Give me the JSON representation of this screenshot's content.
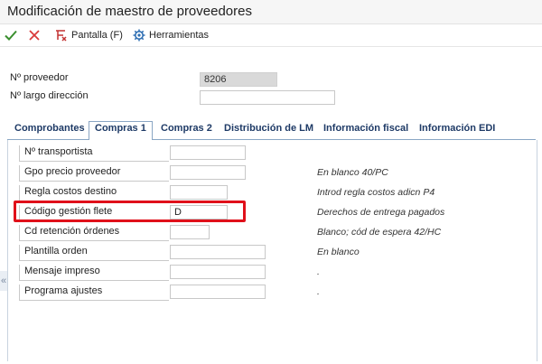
{
  "window": {
    "title": "Modificación de maestro de proveedores"
  },
  "toolbar": {
    "ok_icon": "checkmark-icon",
    "cancel_icon": "x-icon",
    "pantalla_label": "Pantalla (F)",
    "herramientas_label": "Herramientas",
    "colors": {
      "ok": "#3a8f2e",
      "cancel": "#d93a3a",
      "pantalla": "#c23030",
      "herramientas": "#2f6fb3"
    }
  },
  "header": {
    "proveedor_label": "Nº proveedor",
    "proveedor_value": "8206",
    "largo_label": "Nº largo dirección",
    "largo_value": ""
  },
  "tabs": [
    {
      "label": "Comprobantes",
      "active": false
    },
    {
      "label": "Compras 1",
      "active": true
    },
    {
      "label": "Compras 2",
      "active": false
    },
    {
      "label": "Distribución de LM",
      "active": false
    },
    {
      "label": "Información fiscal",
      "active": false
    },
    {
      "label": "Información EDI",
      "active": false
    }
  ],
  "fields": [
    {
      "label": "Nº transportista",
      "value": "",
      "hint": ""
    },
    {
      "label": "Gpo precio proveedor",
      "value": "",
      "hint": "En blanco 40/PC"
    },
    {
      "label": "Regla costos destino",
      "value": "",
      "hint": "Introd regla costos adicn P4"
    },
    {
      "label": "Código gestión flete",
      "value": "D",
      "hint": "Derechos de entrega pagados"
    },
    {
      "label": "Cd retención órdenes",
      "value": "",
      "hint": "Blanco; cód de espera 42/HC"
    },
    {
      "label": "Plantilla orden",
      "value": "",
      "hint": "En blanco"
    },
    {
      "label": "Mensaje impreso",
      "value": "",
      "hint": "."
    },
    {
      "label": "Programa ajustes",
      "value": "",
      "hint": "."
    }
  ],
  "highlight_color": "#e0101a",
  "side_handle": "«"
}
